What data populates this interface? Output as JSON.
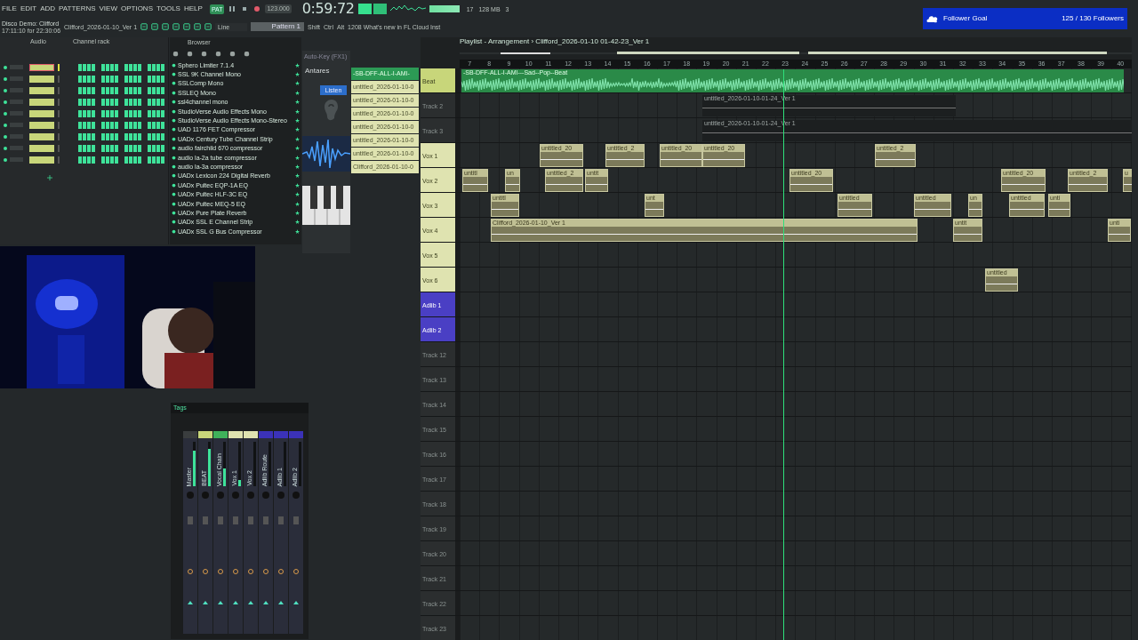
{
  "menu": [
    "FILE",
    "EDIT",
    "ADD",
    "PATTERNS",
    "VIEW",
    "OPTIONS",
    "TOOLS",
    "HELP"
  ],
  "transport": {
    "mode": "PAT",
    "bpm": "123.000",
    "time": "0:59:72",
    "memory": "128 MB",
    "cpu": "17",
    "polyphony": "3",
    "snap": "Line",
    "pattern": "Pattern 1",
    "modifiers": [
      "Shift",
      "Ctrl",
      "Alt"
    ],
    "news": "1208 What's new in FL Cloud Inst"
  },
  "project": {
    "name": "Disco Demo: Clifford",
    "time": "17:11:10 for 22:30:06",
    "file": "Clifford_2026-01-10_Ver 1"
  },
  "channel_rack": {
    "filter": "Audio",
    "title": "Channel rack",
    "channels": [
      {
        "selected": true
      },
      {
        "selected": false
      },
      {
        "selected": false
      },
      {
        "selected": false
      },
      {
        "selected": false
      },
      {
        "selected": false
      },
      {
        "selected": false
      },
      {
        "selected": false
      },
      {
        "selected": false
      }
    ]
  },
  "browser": {
    "title": "Browser",
    "items": [
      "Sphero Limiter 7.1.4",
      "SSL 9K Channel Mono",
      "SSLComp Mono",
      "SSLEQ Mono",
      "ssl4channel mono",
      "StudioVerse Audio Effects Mono",
      "StudioVerse Audio Effects Mono-Stereo",
      "UAD 1176 FET Compressor",
      "UADx Century Tube Channel Strip",
      "audio fairchild 670 compressor",
      "audio la-2a tube compressor",
      "audio la-3a compressor",
      "UADx Lexicon 224 Digital Reverb",
      "UADx Pultec EQP-1A EQ",
      "UADx Pultec HLF-3C EQ",
      "UADx Pultec MEQ-5 EQ",
      "UADx Pure Plate Reverb",
      "UADx SSL E Channel Strip",
      "UADx SSL G Bus Compressor"
    ]
  },
  "plugin": {
    "title": "Auto-Key (FX1)",
    "brand": "Antares",
    "button": "Listen"
  },
  "picker": {
    "items": [
      {
        "label": "-SB-DFF-ALL-I-AMI-",
        "selected": true
      },
      {
        "label": "untitled_2026-01-10-0",
        "selected": false
      },
      {
        "label": "untitled_2026-01-10-0",
        "selected": false
      },
      {
        "label": "untitled_2026-01-10-0",
        "selected": false
      },
      {
        "label": "untitled_2026-01-10-0",
        "selected": false
      },
      {
        "label": "untitled_2026-01-10-0",
        "selected": false
      },
      {
        "label": "untitled_2026-01-10-0",
        "selected": false
      },
      {
        "label": "Clifford_2026-01-10-0",
        "selected": false
      }
    ]
  },
  "follower_goal": {
    "label": "Follower Goal",
    "count": "125 / 130 Followers"
  },
  "playlist": {
    "title": "Playlist - Arrangement › Clifford_2026-01-10 01-42-23_Ver 1",
    "ruler": [
      "7",
      "8",
      "9",
      "10",
      "11",
      "12",
      "13",
      "14",
      "15",
      "16",
      "17",
      "18",
      "19",
      "20",
      "21",
      "22",
      "23",
      "24",
      "25",
      "26",
      "27",
      "28",
      "29",
      "30",
      "31",
      "32",
      "33",
      "34",
      "35",
      "36",
      "37",
      "38",
      "39",
      "40"
    ],
    "tracks": [
      {
        "name": "Beat",
        "color": "#c8d67a",
        "clips": [
          {
            "kind": "audio",
            "label": "-SB-DFF-ALL-I-AMI---Sad--Pop--Beat"
          }
        ]
      },
      {
        "name": "Track 2",
        "color": "#2b2e2f",
        "clips": [
          {
            "kind": "automation",
            "label": "untitled_2026-01-10-01-24_Ver 1"
          }
        ]
      },
      {
        "name": "Track 3",
        "color": "#2b2e2f",
        "clips": [
          {
            "kind": "automation",
            "label": "untitled_2026-01-10-01-24_Ver 1"
          }
        ]
      },
      {
        "name": "Vox 1",
        "color": "#dfe3b0",
        "clips": [
          {
            "kind": "vocal",
            "label": "untitled_20"
          },
          {
            "kind": "vocal",
            "label": "untitled_2"
          },
          {
            "kind": "vocal",
            "label": "untitled_20"
          },
          {
            "kind": "vocal",
            "label": "untitled_20"
          },
          {
            "kind": "vocal",
            "label": "untitled_2"
          }
        ]
      },
      {
        "name": "Vox 2",
        "color": "#dfe3b0",
        "clips": [
          {
            "kind": "vocal",
            "label": "untitl"
          },
          {
            "kind": "vocal",
            "label": "un"
          },
          {
            "kind": "vocal",
            "label": "untitled_2"
          },
          {
            "kind": "vocal",
            "label": "untit"
          },
          {
            "kind": "vocal",
            "label": "untitled_20"
          },
          {
            "kind": "vocal",
            "label": "untitled_20"
          },
          {
            "kind": "vocal",
            "label": "untitled_2"
          },
          {
            "kind": "vocal",
            "label": "u"
          }
        ]
      },
      {
        "name": "Vox 3",
        "color": "#dfe3b0",
        "clips": [
          {
            "kind": "vocal",
            "label": "untitl"
          },
          {
            "kind": "vocal",
            "label": "unt"
          },
          {
            "kind": "vocal",
            "label": "untitled"
          },
          {
            "kind": "vocal",
            "label": "untitled"
          },
          {
            "kind": "vocal",
            "label": "un"
          },
          {
            "kind": "vocal",
            "label": "untitled"
          },
          {
            "kind": "vocal",
            "label": "unti"
          }
        ]
      },
      {
        "name": "Vox 4",
        "color": "#dfe3b0",
        "clips": [
          {
            "kind": "vocal",
            "label": "Clifford_2026-01-10_Ver 1"
          },
          {
            "kind": "vocal",
            "label": "untit"
          },
          {
            "kind": "vocal",
            "label": "unti"
          }
        ]
      },
      {
        "name": "Vox 5",
        "color": "#dfe3b0"
      },
      {
        "name": "Vox 6",
        "color": "#dfe3b0",
        "clips": [
          {
            "kind": "vocal",
            "label": "untitled"
          }
        ]
      },
      {
        "name": "Adlib 1",
        "color": "#4a3fc4"
      },
      {
        "name": "Adlib 2",
        "color": "#4a3fc4"
      },
      {
        "name": "Track 12",
        "color": "#2b2e2f"
      },
      {
        "name": "Track 13",
        "color": "#2b2e2f"
      },
      {
        "name": "Track 14",
        "color": "#2b2e2f"
      },
      {
        "name": "Track 15",
        "color": "#2b2e2f"
      },
      {
        "name": "Track 16",
        "color": "#2b2e2f"
      },
      {
        "name": "Track 17",
        "color": "#2b2e2f"
      },
      {
        "name": "Track 18",
        "color": "#2b2e2f"
      },
      {
        "name": "Track 19",
        "color": "#2b2e2f"
      },
      {
        "name": "Track 20",
        "color": "#2b2e2f"
      },
      {
        "name": "Track 21",
        "color": "#2b2e2f"
      },
      {
        "name": "Track 22",
        "color": "#2b2e2f"
      },
      {
        "name": "Track 23",
        "color": "#2b2e2f"
      }
    ]
  },
  "mixer": {
    "title": "Tags",
    "strips": [
      {
        "name": "Master",
        "color": "#3a3d3e",
        "level": 0.8
      },
      {
        "name": "BEAT",
        "color": "#c8d67a",
        "level": 0.85
      },
      {
        "name": "Vocal Chain",
        "color": "#3fb25a",
        "level": 0.4
      },
      {
        "name": "Vox 1",
        "color": "#dfe3b0",
        "level": 0.15
      },
      {
        "name": "Vox 2",
        "color": "#dfe3b0",
        "level": 0
      },
      {
        "name": "Adlib Route",
        "color": "#3b32b8",
        "level": 0
      },
      {
        "name": "Adlib 1",
        "color": "#3b32b8",
        "level": 0
      },
      {
        "name": "Adlib 2",
        "color": "#3b32b8",
        "level": 0
      }
    ]
  }
}
